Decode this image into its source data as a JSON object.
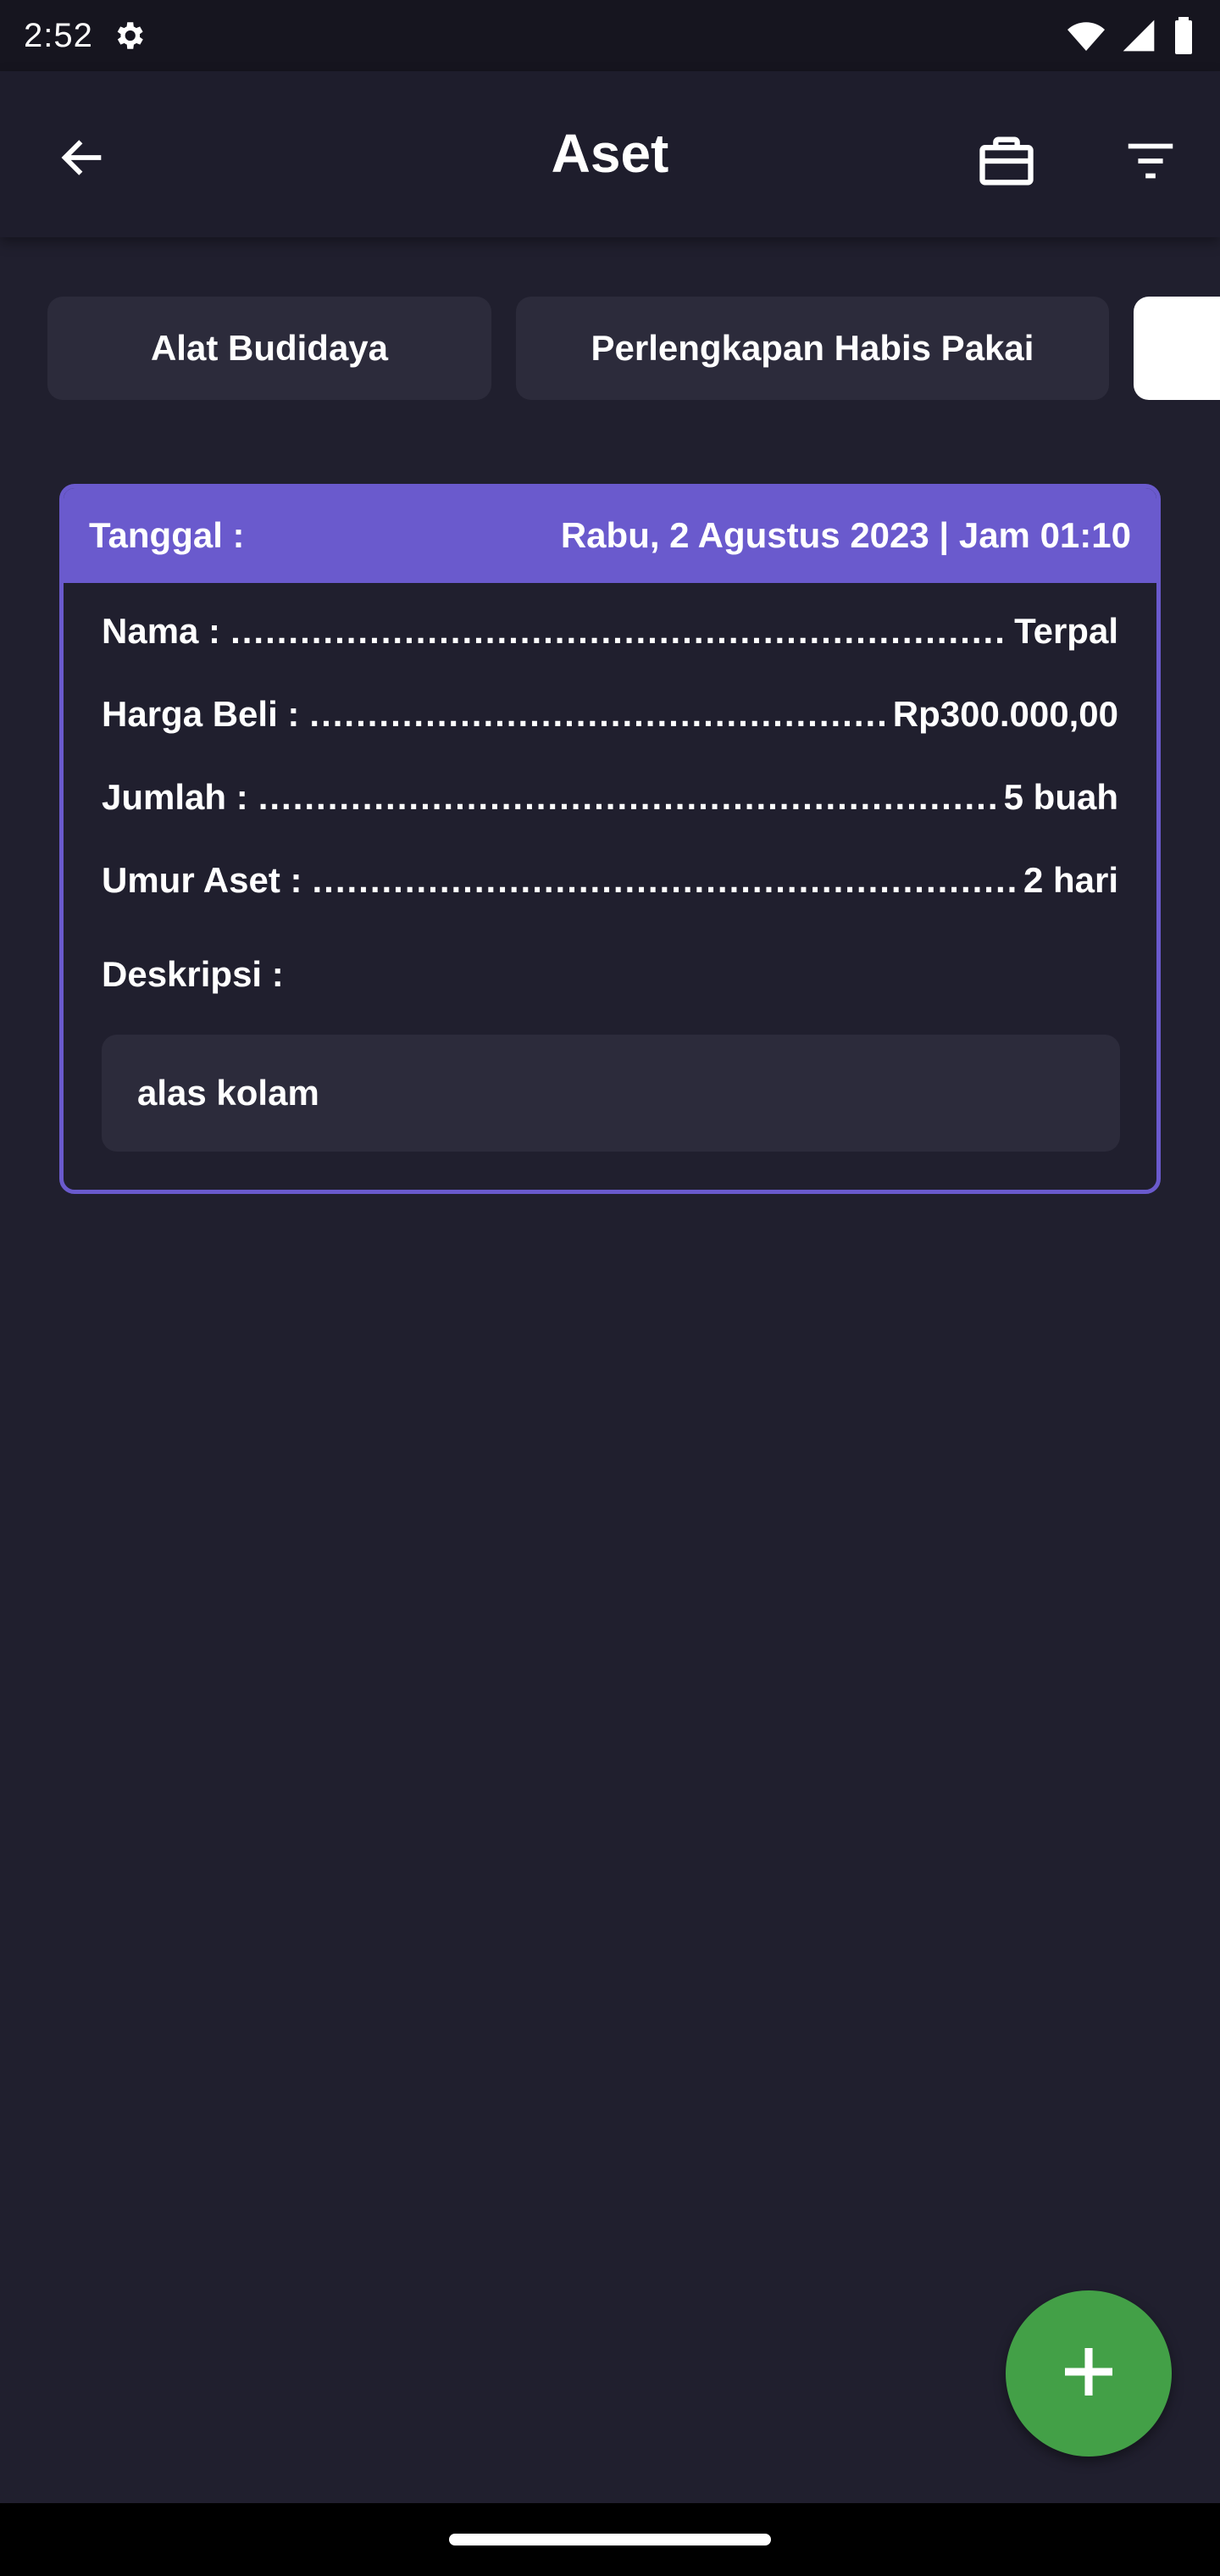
{
  "status_bar": {
    "time": "2:52",
    "icons": [
      "settings-icon",
      "wifi-icon",
      "signal-icon",
      "battery-icon"
    ]
  },
  "app_bar": {
    "title": "Aset",
    "back_icon": "arrow-left-icon",
    "action_icons": [
      "briefcase-icon",
      "filter-icon"
    ]
  },
  "tabs": [
    {
      "label": "Alat Budidaya"
    },
    {
      "label": "Perlengkapan Habis Pakai"
    },
    {
      "label": ""
    }
  ],
  "card": {
    "header_label": "Tanggal :",
    "header_value": "Rabu, 2 Agustus 2023 | Jam 01:10",
    "rows": [
      {
        "label": "Nama :",
        "value": "Terpal"
      },
      {
        "label": "Harga Beli :",
        "value": "Rp300.000,00"
      },
      {
        "label": "Jumlah :",
        "value": "5 buah"
      },
      {
        "label": "Umur Aset :",
        "value": "2 hari"
      }
    ],
    "description_label": "Deskripsi :",
    "description_value": "alas kolam"
  },
  "fab": {
    "icon": "plus-icon"
  },
  "colors": {
    "background": "#201f2e",
    "accent": "#6a5acd",
    "fab": "#43a047",
    "chip": "#2c2b3b"
  }
}
